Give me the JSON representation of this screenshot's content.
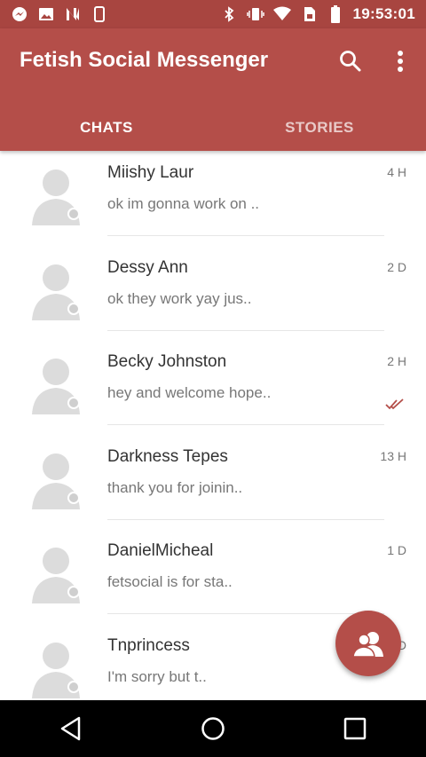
{
  "status_bar": {
    "time": "19:53:01",
    "left_icons": [
      "messenger-icon",
      "image-icon",
      "n-icon",
      "phone-icon"
    ],
    "right_icons": [
      "bluetooth-icon",
      "vibrate-icon",
      "wifi-icon",
      "sim-icon",
      "battery-icon"
    ]
  },
  "app_bar": {
    "title": "Fetish Social Messenger",
    "background": "#b44e49",
    "tabs": [
      {
        "label": "CHATS",
        "active": true
      },
      {
        "label": "STORIES",
        "active": false
      }
    ]
  },
  "chats": [
    {
      "name": "Miishy Laur",
      "snippet": "ok im gonna work on ..",
      "time": "4 H",
      "read": false
    },
    {
      "name": "Dessy Ann",
      "snippet": "ok they work yay jus..",
      "time": "2 D",
      "read": false
    },
    {
      "name": "Becky Johnston",
      "snippet": "hey and welcome hope..",
      "time": "2 H",
      "read": true
    },
    {
      "name": "Darkness Tepes",
      "snippet": "thank you for joinin..",
      "time": "13 H",
      "read": false
    },
    {
      "name": "DanielMicheal",
      "snippet": "fetsocial is for sta..",
      "time": "1 D",
      "read": false
    },
    {
      "name": "Tnprincess",
      "snippet": "I'm sorry but t..",
      "time": "D",
      "read": false
    }
  ],
  "colors": {
    "accent": "#b44e49",
    "status_bar": "#a84540",
    "check": "#b44e49"
  },
  "fab": {
    "icon": "contacts-icon"
  },
  "nav_bar": {
    "icons": [
      "back-icon",
      "home-icon",
      "recents-icon"
    ]
  }
}
